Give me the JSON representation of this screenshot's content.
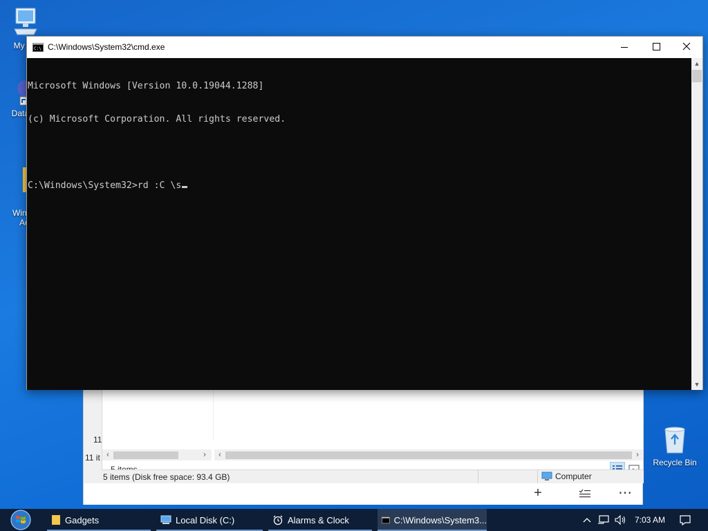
{
  "desktop": {
    "icons": [
      {
        "label": "My Co",
        "icon": "computer-icon"
      },
      {
        "label": "DataW",
        "icon": "shortcut-icon"
      },
      {
        "label": "Windo\nAc",
        "icon": "folder-icon"
      },
      {
        "label": "Recycle Bin",
        "icon": "recycle-bin-icon"
      }
    ]
  },
  "explorer": {
    "left_count_1": "11",
    "left_count_2": "11 it",
    "items_count": "5 items",
    "status_text": "5 items (Disk free space: 93.4 GB)",
    "location": "Computer"
  },
  "cmd": {
    "title": "C:\\Windows\\System32\\cmd.exe",
    "lines": [
      "Microsoft Windows [Version 10.0.19044.1288]",
      "(c) Microsoft Corporation. All rights reserved.",
      "",
      "C:\\Windows\\System32>rd :C \\s"
    ]
  },
  "taskbar": {
    "items": [
      {
        "label": "Gadgets",
        "icon": "folder-icon"
      },
      {
        "label": "Local Disk (C:)",
        "icon": "drive-icon"
      },
      {
        "label": "Alarms & Clock",
        "icon": "alarm-clock-icon"
      },
      {
        "label": "C:\\Windows\\System3...",
        "icon": "cmd-icon",
        "active": true
      }
    ],
    "clock": "7:03 AM"
  },
  "colors": {
    "desktop": "#1b7be0",
    "console_bg": "#0c0c0c",
    "console_text": "#cccccc",
    "taskbar": "#0d1e36"
  }
}
